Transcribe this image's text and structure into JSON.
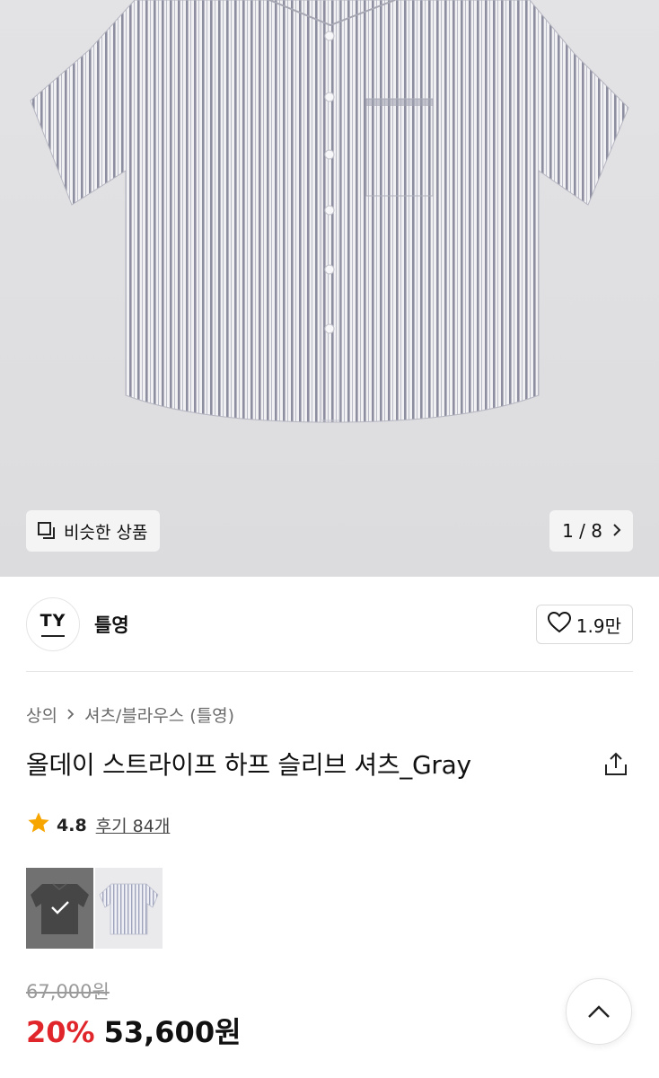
{
  "gallery": {
    "similar_label": "비슷한 상품",
    "counter": "1 / 8"
  },
  "brand": {
    "logo_text": "TY",
    "name": "틀영",
    "likes": "1.9만"
  },
  "breadcrumb": {
    "category": "상의",
    "subcategory": "셔츠/블라우스 (틀영)"
  },
  "product": {
    "title": "올데이 스트라이프 하프 슬리브 셔츠_Gray",
    "rating": "4.8",
    "reviews": "후기 84개",
    "original_price": "67,000원",
    "discount": "20%",
    "sale_price": "53,600원"
  },
  "options": {
    "colors": [
      {
        "name": "charcoal",
        "selected": true
      },
      {
        "name": "gray",
        "selected": false
      }
    ]
  },
  "colors": {
    "discount": "#e0262b",
    "star": "#f7a600"
  },
  "icons": [
    "similar-icon",
    "chevron-right-icon",
    "heart-icon",
    "share-icon",
    "star-icon",
    "check-icon",
    "chevron-up-icon"
  ]
}
